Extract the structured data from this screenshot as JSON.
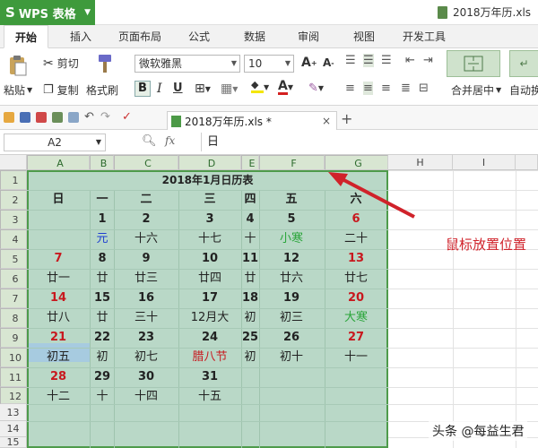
{
  "app": {
    "logo": "WPS 表格",
    "file_title": "2018万年历.xls"
  },
  "tabs": [
    "开始",
    "插入",
    "页面布局",
    "公式",
    "数据",
    "审阅",
    "视图",
    "开发工具"
  ],
  "ribbon": {
    "paste": "粘贴",
    "cut": "剪切",
    "copy": "复制",
    "format_painter": "格式刷",
    "font": "微软雅黑",
    "size": "10",
    "bold": "B",
    "italic": "I",
    "underline": "U",
    "merge_center": "合并居中",
    "auto_wrap": "自动换"
  },
  "doc_tab": {
    "name": "2018万年历.xls *",
    "close": "×"
  },
  "formula": {
    "name_box": "A2",
    "fx": "fx",
    "value": "日"
  },
  "columns": [
    "A",
    "B",
    "C",
    "D",
    "E",
    "F",
    "G",
    "H",
    "I"
  ],
  "rows": [
    "1",
    "2",
    "3",
    "4",
    "5",
    "6",
    "7",
    "8",
    "9",
    "10",
    "11",
    "12",
    "13",
    "14",
    "15"
  ],
  "calendar": {
    "title": "2018年1月日历表",
    "weekdays": [
      "日",
      "一",
      "二",
      "三",
      "四",
      "五",
      "六"
    ],
    "weeks": [
      {
        "nums": [
          "",
          "1",
          "2",
          "3",
          "4",
          "5",
          "6"
        ],
        "lunar": [
          "",
          "元",
          "十六",
          "十七",
          "十",
          "小寒",
          "二十"
        ]
      },
      {
        "nums": [
          "7",
          "8",
          "9",
          "10",
          "11",
          "12",
          "13"
        ],
        "lunar": [
          "廿一",
          "廿",
          "廿三",
          "廿四",
          "廿",
          "廿六",
          "廿七"
        ]
      },
      {
        "nums": [
          "14",
          "15",
          "16",
          "17",
          "18",
          "19",
          "20"
        ],
        "lunar": [
          "廿八",
          "廿",
          "三十",
          "12月大",
          "初",
          "初三",
          "大寒"
        ]
      },
      {
        "nums": [
          "21",
          "22",
          "23",
          "24",
          "25",
          "26",
          "27"
        ],
        "lunar": [
          "初五",
          "初",
          "初七",
          "腊八节",
          "初",
          "初十",
          "十一"
        ]
      },
      {
        "nums": [
          "28",
          "29",
          "30",
          "31",
          "",
          "",
          ""
        ],
        "lunar": [
          "十二",
          "十",
          "十四",
          "十五",
          "",
          "",
          ""
        ]
      }
    ]
  },
  "annotation": "鼠标放置位置",
  "watermark": "头条 @每益生君",
  "colors": {
    "accent_green": "#3e9a3c",
    "calendar_bg": "#b9d8c7",
    "holiday_red": "#c8181e",
    "solar_term_green": "#2aa53a",
    "new_year_blue": "#1f3fd0"
  }
}
